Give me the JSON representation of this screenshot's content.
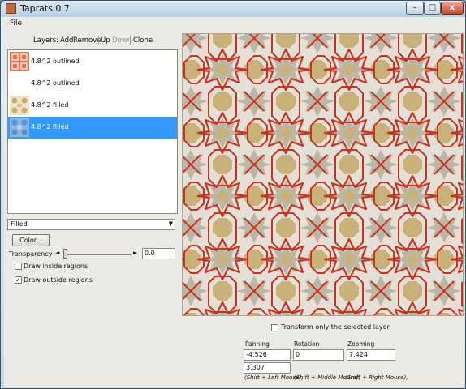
{
  "window": {
    "title": "Taprats 0.7",
    "minimize_label": "–",
    "maximize_label": "□",
    "close_label": "x"
  },
  "menu": {
    "file": "File"
  },
  "layers_toolbar": {
    "label": "Layers:",
    "add": "Add",
    "remove": "Remove",
    "up": "Up",
    "down": "Down",
    "clone": "Clone"
  },
  "layers": [
    {
      "name": "4.8^2 outlined"
    },
    {
      "name": "4.8^2 outlined"
    },
    {
      "name": "4.8^2 filled"
    },
    {
      "name": "4.8^2 filled"
    }
  ],
  "render_style": {
    "selected": "Filled"
  },
  "color_button": "Color...",
  "transparency": {
    "label": "Transparency",
    "value": "0.0",
    "level": 0
  },
  "draw_inside": {
    "label": "Draw inside regions",
    "checked": false
  },
  "draw_outside": {
    "label": "Draw outside regions",
    "checked": true
  },
  "transform_only_selected": {
    "label": "Transform only the selected layer",
    "checked": false
  },
  "panning": {
    "label": "Panning",
    "x": "-4,526",
    "y": "3,307",
    "hint": "(Shift + Left Mouse),"
  },
  "rotation": {
    "label": "Rotation",
    "value": "0",
    "hint": "(Shift + Middle Mouse),"
  },
  "zooming": {
    "label": "Zooming",
    "value": "7,424",
    "hint": "(Shift + Right Mouse),"
  },
  "colors": {
    "selection": "#3399ff",
    "pattern_background": "#e4e0d7",
    "star_fill": "#bcb6a6",
    "octagon_fill": "#c8b27a",
    "outline_red": "#c8341e"
  }
}
